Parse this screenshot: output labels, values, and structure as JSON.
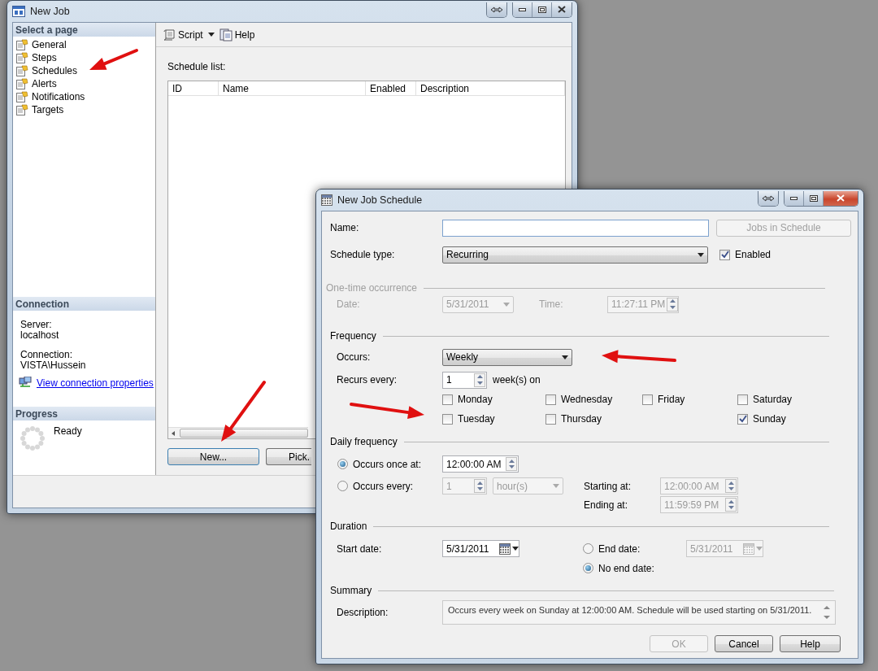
{
  "main_window": {
    "title": "New Job",
    "sidebar_heading": "Select a page",
    "pages": [
      {
        "label": "General"
      },
      {
        "label": "Steps"
      },
      {
        "label": "Schedules"
      },
      {
        "label": "Alerts"
      },
      {
        "label": "Notifications"
      },
      {
        "label": "Targets"
      }
    ],
    "toolbar": {
      "script": "Script",
      "help": "Help"
    },
    "connection": {
      "heading": "Connection",
      "server_label": "Server:",
      "server": "localhost",
      "connection_label": "Connection:",
      "connection": "VISTA\\Hussein",
      "link": "View connection properties"
    },
    "progress": {
      "heading": "Progress",
      "status": "Ready"
    },
    "schedule_list": {
      "label": "Schedule list:",
      "columns": [
        "ID",
        "Name",
        "Enabled",
        "Description"
      ]
    },
    "buttons": [
      "New...",
      "Pick."
    ]
  },
  "dialog": {
    "title": "New Job Schedule",
    "name": {
      "label": "Name:"
    },
    "jobs_button": {
      "label": "Jobs in Schedule",
      "disabled": true
    },
    "schedule_type": {
      "label": "Schedule type:",
      "value": "Recurring"
    },
    "enabled_checkbox": {
      "label": "Enabled",
      "checked": true
    },
    "one_time": {
      "heading": "One-time occurrence",
      "disabled": true,
      "date_label": "Date:",
      "date": "5/31/2011",
      "time_label": "Time:",
      "time": "11:27:11 PM"
    },
    "frequency": {
      "heading": "Frequency",
      "occurs_label": "Occurs:",
      "occurs": "Weekly",
      "recurs_label": "Recurs every:",
      "recurs": "1",
      "unit": "week(s) on",
      "day_columns": [
        [
          {
            "label": "Monday",
            "checked": false
          },
          {
            "label": "Tuesday",
            "checked": false
          }
        ],
        [
          {
            "label": "Wednesday",
            "checked": false
          },
          {
            "label": "Thursday",
            "checked": false
          }
        ],
        [
          {
            "label": "Friday",
            "checked": false
          }
        ],
        [
          {
            "label": "Saturday",
            "checked": false
          },
          {
            "label": "Sunday",
            "checked": true
          }
        ]
      ]
    },
    "daily_frequency": {
      "heading": "Daily frequency",
      "options": [
        {
          "label": "Occurs once at:",
          "selected": true,
          "value": "12:00:00 AM"
        },
        {
          "label": "Occurs every:",
          "selected": false,
          "value": "1",
          "unit": "hour(s)"
        }
      ],
      "starting_label": "Starting at:",
      "starting": "12:00:00 AM",
      "ending_label": "Ending at:",
      "ending": "11:59:59 PM"
    },
    "duration": {
      "heading": "Duration",
      "start_label": "Start date:",
      "start": "5/31/2011",
      "end_options": [
        {
          "label": "End date:",
          "selected": false,
          "value": "5/31/2011"
        },
        {
          "label": "No end date:",
          "selected": true
        }
      ]
    },
    "summary": {
      "heading": "Summary",
      "description_label": "Description:",
      "description": "Occurs every week on Sunday at 12:00:00 AM. Schedule will be used starting on 5/31/2011."
    },
    "buttons": [
      {
        "label": "OK",
        "disabled": true
      },
      {
        "label": "Cancel",
        "disabled": false
      },
      {
        "label": "Help",
        "disabled": false
      }
    ]
  }
}
